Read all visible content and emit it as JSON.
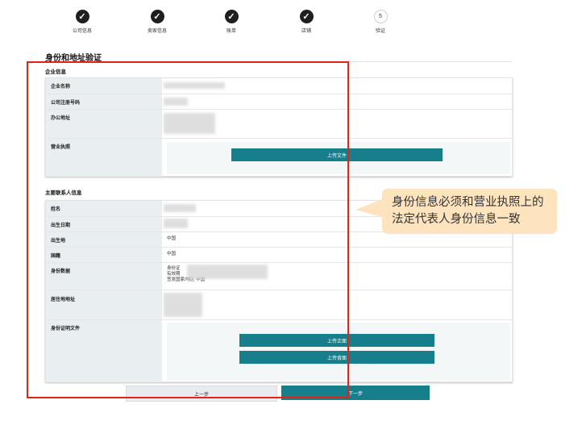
{
  "stepper": {
    "steps": [
      {
        "label": "公司信息",
        "state": "done",
        "icon": "check-icon"
      },
      {
        "label": "卖家信息",
        "state": "done",
        "icon": "check-icon"
      },
      {
        "label": "账单",
        "state": "done",
        "icon": "check-icon"
      },
      {
        "label": "店铺",
        "state": "done",
        "icon": "check-icon"
      },
      {
        "label": "验证",
        "state": "current",
        "number": "5"
      }
    ]
  },
  "page": {
    "title": "身份和地址验证"
  },
  "company_section": {
    "title": "企业信息",
    "rows": [
      {
        "key": "企业名称",
        "value": ""
      },
      {
        "key": "公司注册号码",
        "value": ""
      },
      {
        "key": "办公地址",
        "value": ""
      },
      {
        "key": "营业执照",
        "value": ""
      }
    ],
    "upload_label": "上传文件"
  },
  "contact_section": {
    "title": "主要联系人信息",
    "rows": [
      {
        "key": "姓名",
        "value": ""
      },
      {
        "key": "出生日期",
        "value": ""
      },
      {
        "key": "出生地",
        "value": "中国"
      },
      {
        "key": "国籍",
        "value": "中国"
      },
      {
        "key": "身份数据",
        "lines": [
          "身份证",
          "有效期",
          "签发国家/地区",
          "中国"
        ]
      },
      {
        "key": "居住地地址",
        "value": ""
      },
      {
        "key": "身份证明文件",
        "value": ""
      }
    ],
    "upload_front_label": "上传正面",
    "upload_back_label": "上传背面"
  },
  "footer": {
    "prev_label": "上一步",
    "next_label": "下一步"
  },
  "annotation": {
    "text_line1": "身份信息必须和营业执照上的",
    "text_line2": "法定代表人身份信息一致"
  },
  "colors": {
    "accent": "#177f8c",
    "highlight": "#e2231a",
    "callout_bg": "#fde4bf"
  }
}
